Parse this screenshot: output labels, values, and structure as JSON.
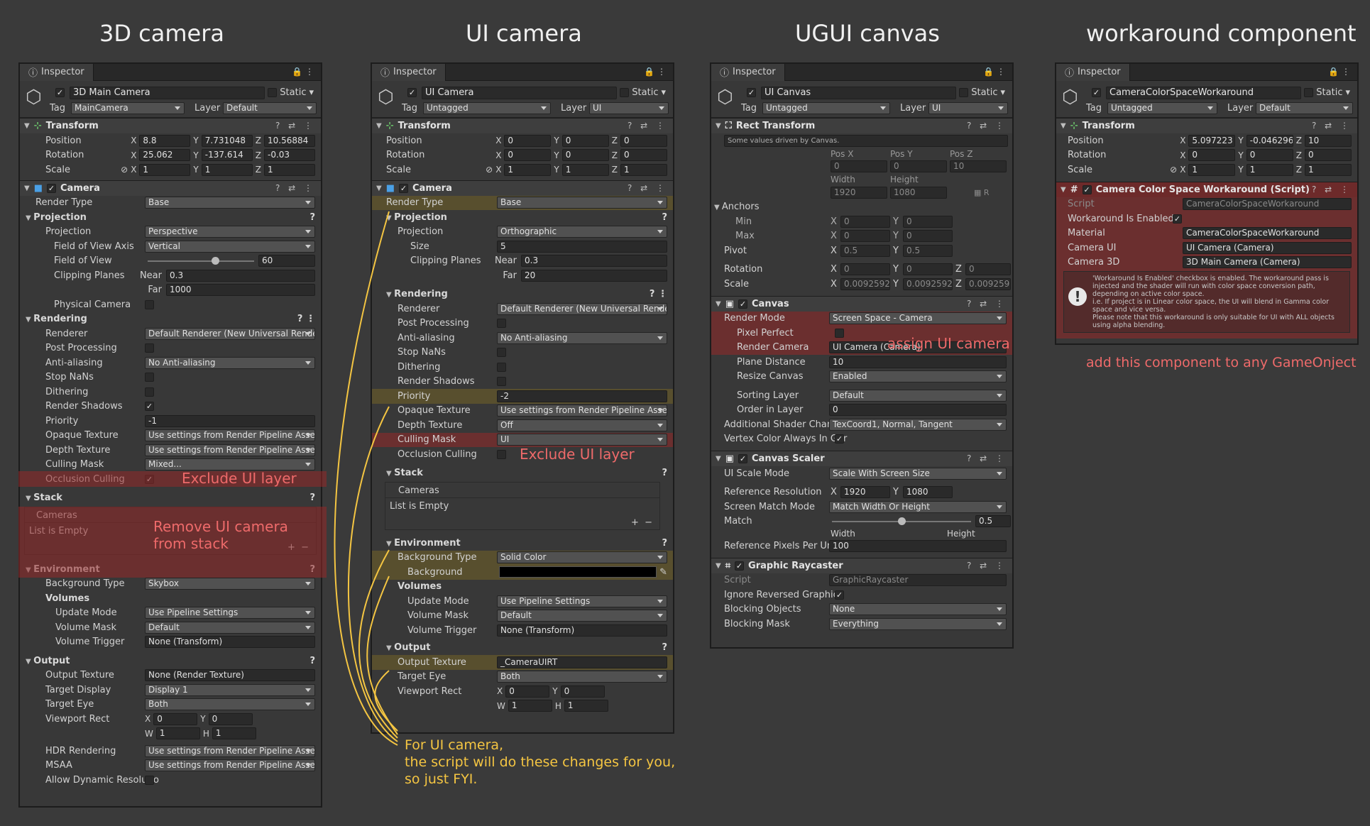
{
  "titles": {
    "cam3d": "3D camera",
    "uicam": "UI camera",
    "canvas": "UGUI canvas",
    "work": "workaround component"
  },
  "colors": {
    "bg": "#3a3a3a",
    "panel": "#383838",
    "note_red": "#ee6a6a",
    "note_yellow": "#f4c542"
  },
  "common": {
    "tab": "Inspector",
    "static": "Static",
    "tag": "Tag",
    "layer": "Layer",
    "x": "X",
    "y": "Y",
    "z": "Z",
    "w": "W",
    "h": "H",
    "near": "Near",
    "far": "Far",
    "min": "Min",
    "max": "Max",
    "width": "Width",
    "height": "Height",
    "pos_x": "Pos X",
    "pos_y": "Pos Y",
    "pos_z": "Pos Z",
    "r": "R"
  },
  "cam3d": {
    "name": "3D Main Camera",
    "tag": "MainCamera",
    "layer": "Default",
    "transform": "Transform",
    "position": "Position",
    "rotation": "Rotation",
    "scale": "Scale",
    "pos": [
      "8.8",
      "7.731048",
      "10.56884"
    ],
    "rot": [
      "25.062",
      "-137.614",
      "-0.03"
    ],
    "scl": [
      "1",
      "1",
      "1"
    ],
    "camera": "Camera",
    "render_type": "Render Type",
    "render_type_v": "Base",
    "projection_h": "Projection",
    "projection": "Projection",
    "projection_v": "Perspective",
    "fov_axis": "Field of View Axis",
    "fov_axis_v": "Vertical",
    "fov": "Field of View",
    "fov_v": "60",
    "clip": "Clipping Planes",
    "near_v": "0.3",
    "far_v": "1000",
    "physical": "Physical Camera",
    "rendering_h": "Rendering",
    "renderer": "Renderer",
    "renderer_v": "Default Renderer (New Universal Rende",
    "post": "Post Processing",
    "aa": "Anti-aliasing",
    "aa_v": "No Anti-aliasing",
    "stopnans": "Stop NaNs",
    "dither": "Dithering",
    "shadows": "Render Shadows",
    "priority": "Priority",
    "priority_v": "-1",
    "opaque": "Opaque Texture",
    "opaque_v": "Use settings from Render Pipeline Asset",
    "depth": "Depth Texture",
    "depth_v": "Use settings from Render Pipeline Asset",
    "culling": "Culling Mask",
    "culling_v": "Mixed...",
    "occlusion": "Occlusion Culling",
    "stack_h": "Stack",
    "cameras": "Cameras",
    "list_empty": "List is Empty",
    "env_h": "Environment",
    "bgtype": "Background Type",
    "bgtype_v": "Skybox",
    "volumes": "Volumes",
    "update": "Update Mode",
    "update_v": "Use Pipeline Settings",
    "vmask": "Volume Mask",
    "vmask_v": "Default",
    "vtrigger": "Volume Trigger",
    "vtrigger_v": "None (Transform)",
    "output_h": "Output",
    "outtex": "Output Texture",
    "outtex_v": "None (Render Texture)",
    "display": "Target Display",
    "display_v": "Display 1",
    "eye": "Target Eye",
    "eye_v": "Both",
    "viewport": "Viewport Rect",
    "vp": [
      "0",
      "0",
      "1",
      "1"
    ],
    "hdr": "HDR Rendering",
    "hdr_v": "Use settings from Render Pipeline Asset",
    "msaa": "MSAA",
    "msaa_v": "Use settings from Render Pipeline Asset",
    "dyn": "Allow Dynamic Resolutio",
    "note_cull": "Exclude UI layer",
    "note_stack1": "Remove UI camera",
    "note_stack2": "from stack"
  },
  "uicam": {
    "name": "UI Camera",
    "tag": "Untagged",
    "layer": "UI",
    "pos": [
      "0",
      "0",
      "0"
    ],
    "rot": [
      "0",
      "0",
      "0"
    ],
    "scl": [
      "1",
      "1",
      "1"
    ],
    "render_type_v": "Base",
    "projection_v": "Orthographic",
    "size": "Size",
    "size_v": "5",
    "near_v": "0.3",
    "far_v": "20",
    "renderer_v": "Default Renderer (New Universal Rende",
    "aa_v": "No Anti-aliasing",
    "priority_v": "-2",
    "opaque_v": "Use settings from Render Pipeline Asset",
    "depth_v": "Off",
    "culling_v": "UI",
    "bgtype_v": "Solid Color",
    "background": "Background",
    "update_v": "Use Pipeline Settings",
    "vmask_v": "Default",
    "vtrigger_v": "None (Transform)",
    "outtex_v": "_CameraUIRT",
    "eye_v": "Both",
    "vp": [
      "0",
      "0",
      "1",
      "1"
    ],
    "note_cull": "Exclude UI layer",
    "note1": "For UI camera,",
    "note2": "the script will do these changes for you,",
    "note3": "so just FYI."
  },
  "canvas": {
    "name": "UI Canvas",
    "tag": "Untagged",
    "layer": "UI",
    "rect": "Rect Transform",
    "driven": "Some values driven by Canvas.",
    "pos": [
      "0",
      "0",
      "10"
    ],
    "size": [
      "1920",
      "1080"
    ],
    "anchors": "Anchors",
    "amin": [
      "0",
      "0"
    ],
    "amax": [
      "0",
      "0"
    ],
    "pivot": "Pivot",
    "pivot_v": [
      "0.5",
      "0.5"
    ],
    "rotation": "Rotation",
    "rot": [
      "0",
      "0",
      "0"
    ],
    "scale": "Scale",
    "scl": [
      "0.0092592",
      "0.0092592",
      "0.0092592"
    ],
    "canvas": "Canvas",
    "rmode": "Render Mode",
    "rmode_v": "Screen Space - Camera",
    "pixel": "Pixel Perfect",
    "rcam": "Render Camera",
    "rcam_v": "UI Camera (Camera)",
    "plane": "Plane Distance",
    "plane_v": "10",
    "resize": "Resize Canvas",
    "resize_v": "Enabled",
    "sorting": "Sorting Layer",
    "sorting_v": "Default",
    "order": "Order in Layer",
    "order_v": "0",
    "shader": "Additional Shader Channel",
    "shader_v": "TexCoord1, Normal, Tangent",
    "vcolor": "Vertex Color Always In Gar",
    "scaler": "Canvas Scaler",
    "uimode": "UI Scale Mode",
    "uimode_v": "Scale With Screen Size",
    "refres": "Reference Resolution",
    "refres_v": [
      "1920",
      "1080"
    ],
    "match_mode": "Screen Match Mode",
    "match_mode_v": "Match Width Or Height",
    "match": "Match",
    "match_v": "0.5",
    "match_frac": 0.5,
    "ppu": "Reference Pixels Per Unit",
    "ppu_v": "100",
    "raycaster": "Graphic Raycaster",
    "script": "Script",
    "script_v": "GraphicRaycaster",
    "ignore": "Ignore Reversed Graphics",
    "blocking": "Blocking Objects",
    "blocking_v": "None",
    "bmask": "Blocking Mask",
    "bmask_v": "Everything",
    "note": "assign UI camera"
  },
  "work": {
    "name": "CameraColorSpaceWorkaround",
    "tag": "Untagged",
    "layer": "Default",
    "pos": [
      "5.097223",
      "-0.046296",
      "10"
    ],
    "rot": [
      "0",
      "0",
      "0"
    ],
    "scl": [
      "1",
      "1",
      "1"
    ],
    "comp": "Camera Color Space Workaround (Script)",
    "script": "Script",
    "script_v": "CameraColorSpaceWorkaround",
    "enabled": "Workaround Is Enabled",
    "material": "Material",
    "material_v": "CameraColorSpaceWorkaround",
    "camui": "Camera UI",
    "camui_v": "UI Camera (Camera)",
    "cam3d": "Camera 3D",
    "cam3d_v": "3D Main Camera (Camera)",
    "info1": "'Workaround Is Enabled' checkbox is enabled. The workaround pass is",
    "info2": "injected and the shader will run with color space conversion path,",
    "info3": "depending on active color space.",
    "info4": "i.e. If project is in Linear color space, the UI will blend in Gamma color",
    "info5": "space and vice versa.",
    "info6": "Please note that this workaround is only suitable for UI with ALL objects",
    "info7": "using alpha blending.",
    "note": "add this component to any GameOnject"
  }
}
